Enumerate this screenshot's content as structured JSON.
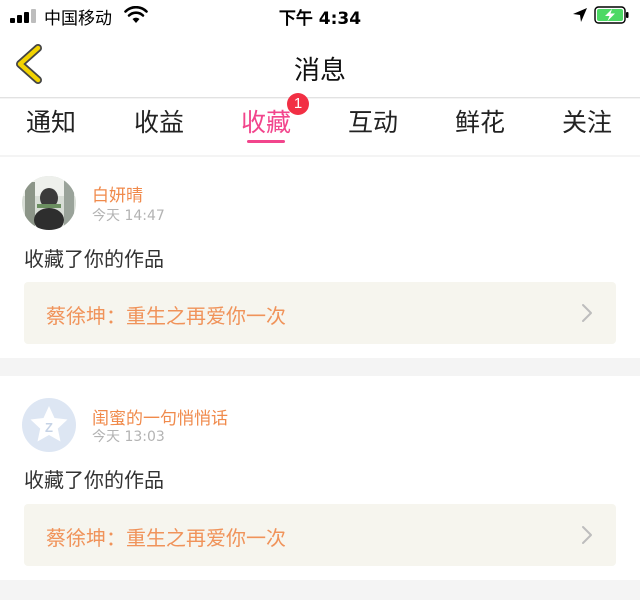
{
  "status_bar": {
    "carrier": "中国移动",
    "time": "下午 4:34"
  },
  "header": {
    "title": "消息"
  },
  "tabs": [
    {
      "label": "通知",
      "active": false
    },
    {
      "label": "收益",
      "active": false
    },
    {
      "label": "收藏",
      "active": true,
      "badge": "1"
    },
    {
      "label": "互动",
      "active": false
    },
    {
      "label": "鲜花",
      "active": false
    },
    {
      "label": "关注",
      "active": false
    }
  ],
  "messages": [
    {
      "user": "白妍晴",
      "time": "今天 14:47",
      "action": "收藏了你的作品",
      "work": "蔡徐坤：重生之再爱你一次",
      "avatar_icon": "photo-avatar-icon"
    },
    {
      "user": "闺蜜的一句悄悄话",
      "time": "今天 13:03",
      "action": "收藏了你的作品",
      "work": "蔡徐坤：重生之再爱你一次",
      "avatar_icon": "default-avatar-icon"
    }
  ],
  "colors": {
    "accent": "#f2458c",
    "badge": "#f22f44",
    "username": "#f08a4b",
    "work_title": "#f0935a",
    "work_bg": "#f6f5ee",
    "back_arrow": "#f2d300",
    "battery": "#4cd964"
  }
}
